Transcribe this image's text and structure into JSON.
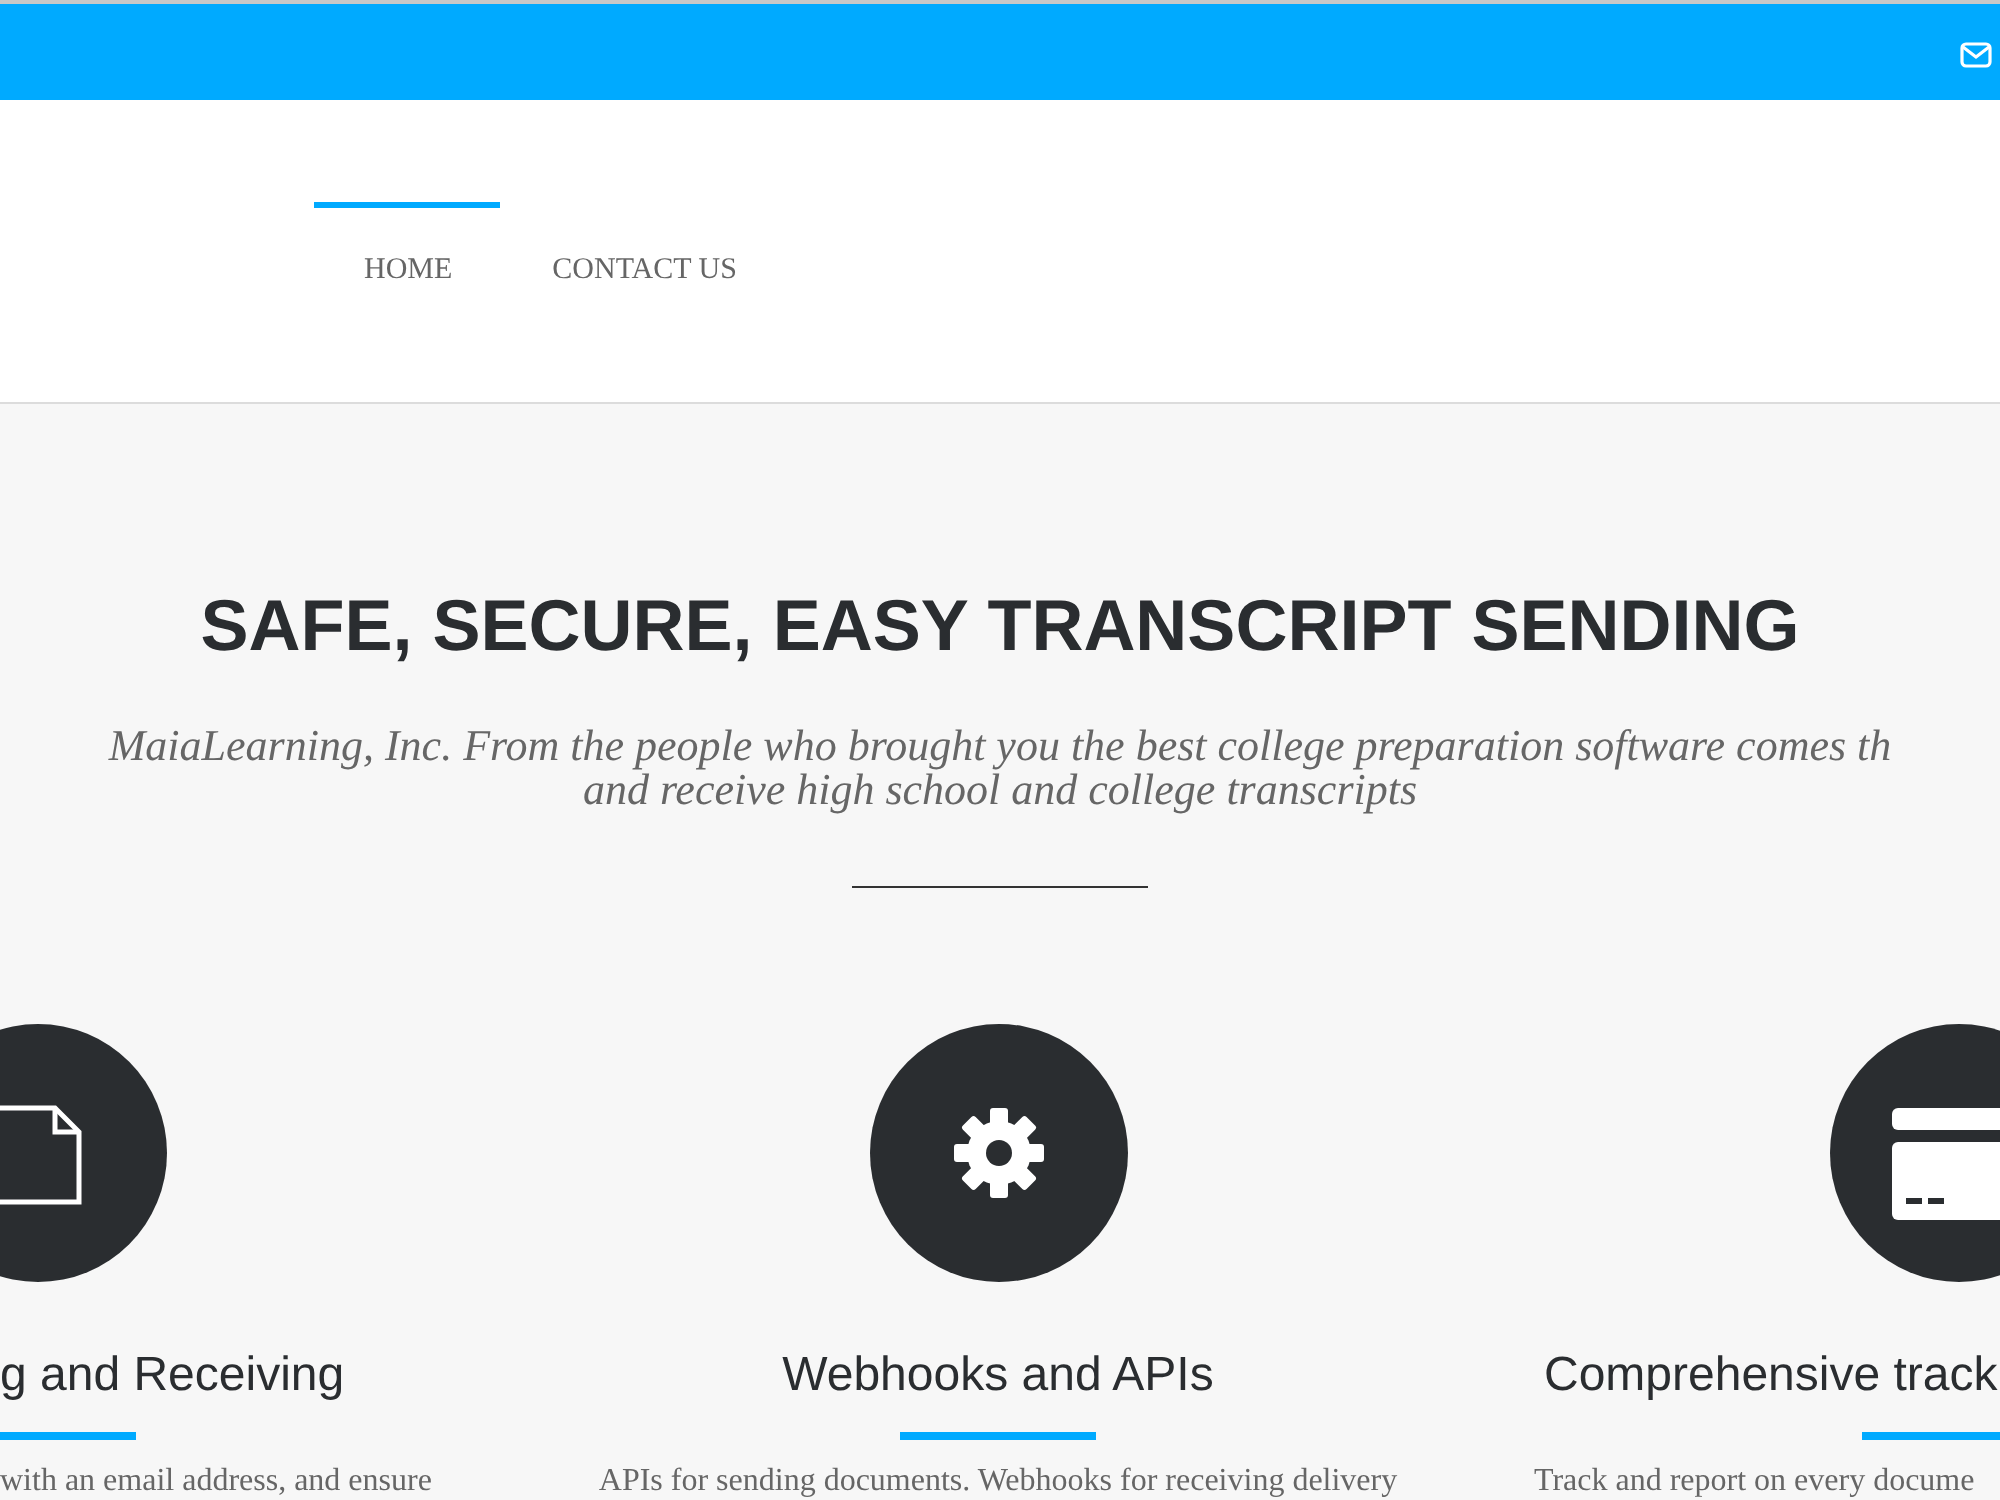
{
  "nav": [
    {
      "label": "HOME",
      "selected": true
    },
    {
      "label": "CONTACT US",
      "selected": false
    }
  ],
  "hero": {
    "heading": "SAFE, SECURE, EASY TRANSCRIPT SENDING",
    "subtitle_lines": [
      "MaiaLearning, Inc. From the people who brought you the best college preparation software comes th",
      "and receive high school and college transcripts"
    ]
  },
  "features": [
    {
      "title": "g and Receiving",
      "description": "with an email address, and ensure"
    },
    {
      "title": "Webhooks and APIs",
      "description": "APIs for sending documents. Webhooks for receiving delivery"
    },
    {
      "title": "Comprehensive track",
      "description": "Track and report on every docume"
    }
  ]
}
